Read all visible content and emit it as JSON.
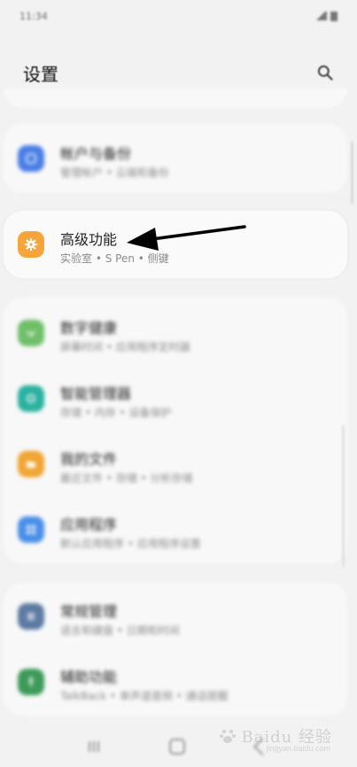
{
  "status_bar": {
    "time": "11:34"
  },
  "header": {
    "title": "设置"
  },
  "items": [
    {
      "title": "帐户与备份",
      "sub": "管理帐户 • 云端和备份",
      "color": "#4a7ee6",
      "icon": "cloud-sync-icon"
    },
    {
      "title": "高级功能",
      "sub": "实验室 • S Pen • 侧键",
      "color": "#f7a53a",
      "icon": "advanced-gear-icon"
    },
    {
      "title": "数字健康",
      "sub": "屏幕时间 • 应用程序定时器",
      "color": "#6fbf6a",
      "icon": "digital-wellbeing-icon"
    },
    {
      "title": "智能管理器",
      "sub": "存储 • 内存 • 设备保护",
      "color": "#2ab1a0",
      "icon": "device-care-icon"
    },
    {
      "title": "我的文件",
      "sub": "最近文件 • 存储 • 分析存储",
      "color": "#f1a534",
      "icon": "folder-icon"
    },
    {
      "title": "应用程序",
      "sub": "默认应用程序 • 应用程序设置",
      "color": "#4a8fe8",
      "icon": "apps-grid-icon"
    },
    {
      "title": "常规管理",
      "sub": "语言和键盘 • 日期和时间",
      "color": "#5d7aa3",
      "icon": "general-management-icon"
    },
    {
      "title": "辅助功能",
      "sub": "TalkBack • 单声道音频 • 通话提醒",
      "color": "#3e9a5a",
      "icon": "accessibility-icon"
    }
  ],
  "watermark": {
    "text": "Baidu 经验",
    "sub": "jingyan.baidu.com"
  }
}
